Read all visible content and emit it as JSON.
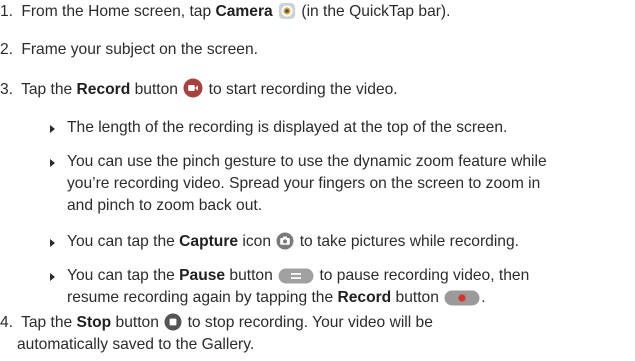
{
  "steps": [
    {
      "num": "1.",
      "pre": "From the Home screen, tap ",
      "bold": "Camera",
      "post": " (in the QuickTap bar)."
    },
    {
      "num": "2.",
      "text": "Frame your subject on the screen."
    },
    {
      "num": "3.",
      "pre": "Tap the ",
      "bold": "Record",
      "mid": " button",
      "post": " to start recording the video."
    },
    {
      "num": "4.",
      "pre": "Tap the ",
      "bold": "Stop",
      "mid": " button",
      "post": " to stop recording. Your video will be",
      "cont": "automatically saved to the Gallery."
    }
  ],
  "bullets": [
    {
      "text": "The length of the recording is displayed at the top of the screen."
    },
    {
      "line1": "You can use the pinch gesture to use the dynamic zoom feature while",
      "line2": "you’re recording video. Spread your fingers on the screen to zoom in",
      "line3": "and pinch to zoom back out."
    },
    {
      "pre": "You can tap the ",
      "bold": "Capture",
      "mid": " icon",
      "post": " to take pictures while recording."
    },
    {
      "pre": "You can tap the ",
      "bold": "Pause",
      "mid": " button",
      "post": " to pause recording video, then",
      "line2pre": "resume recording again by tapping the ",
      "bold2": "Record",
      "line2mid": " button",
      "line2post": "."
    }
  ]
}
